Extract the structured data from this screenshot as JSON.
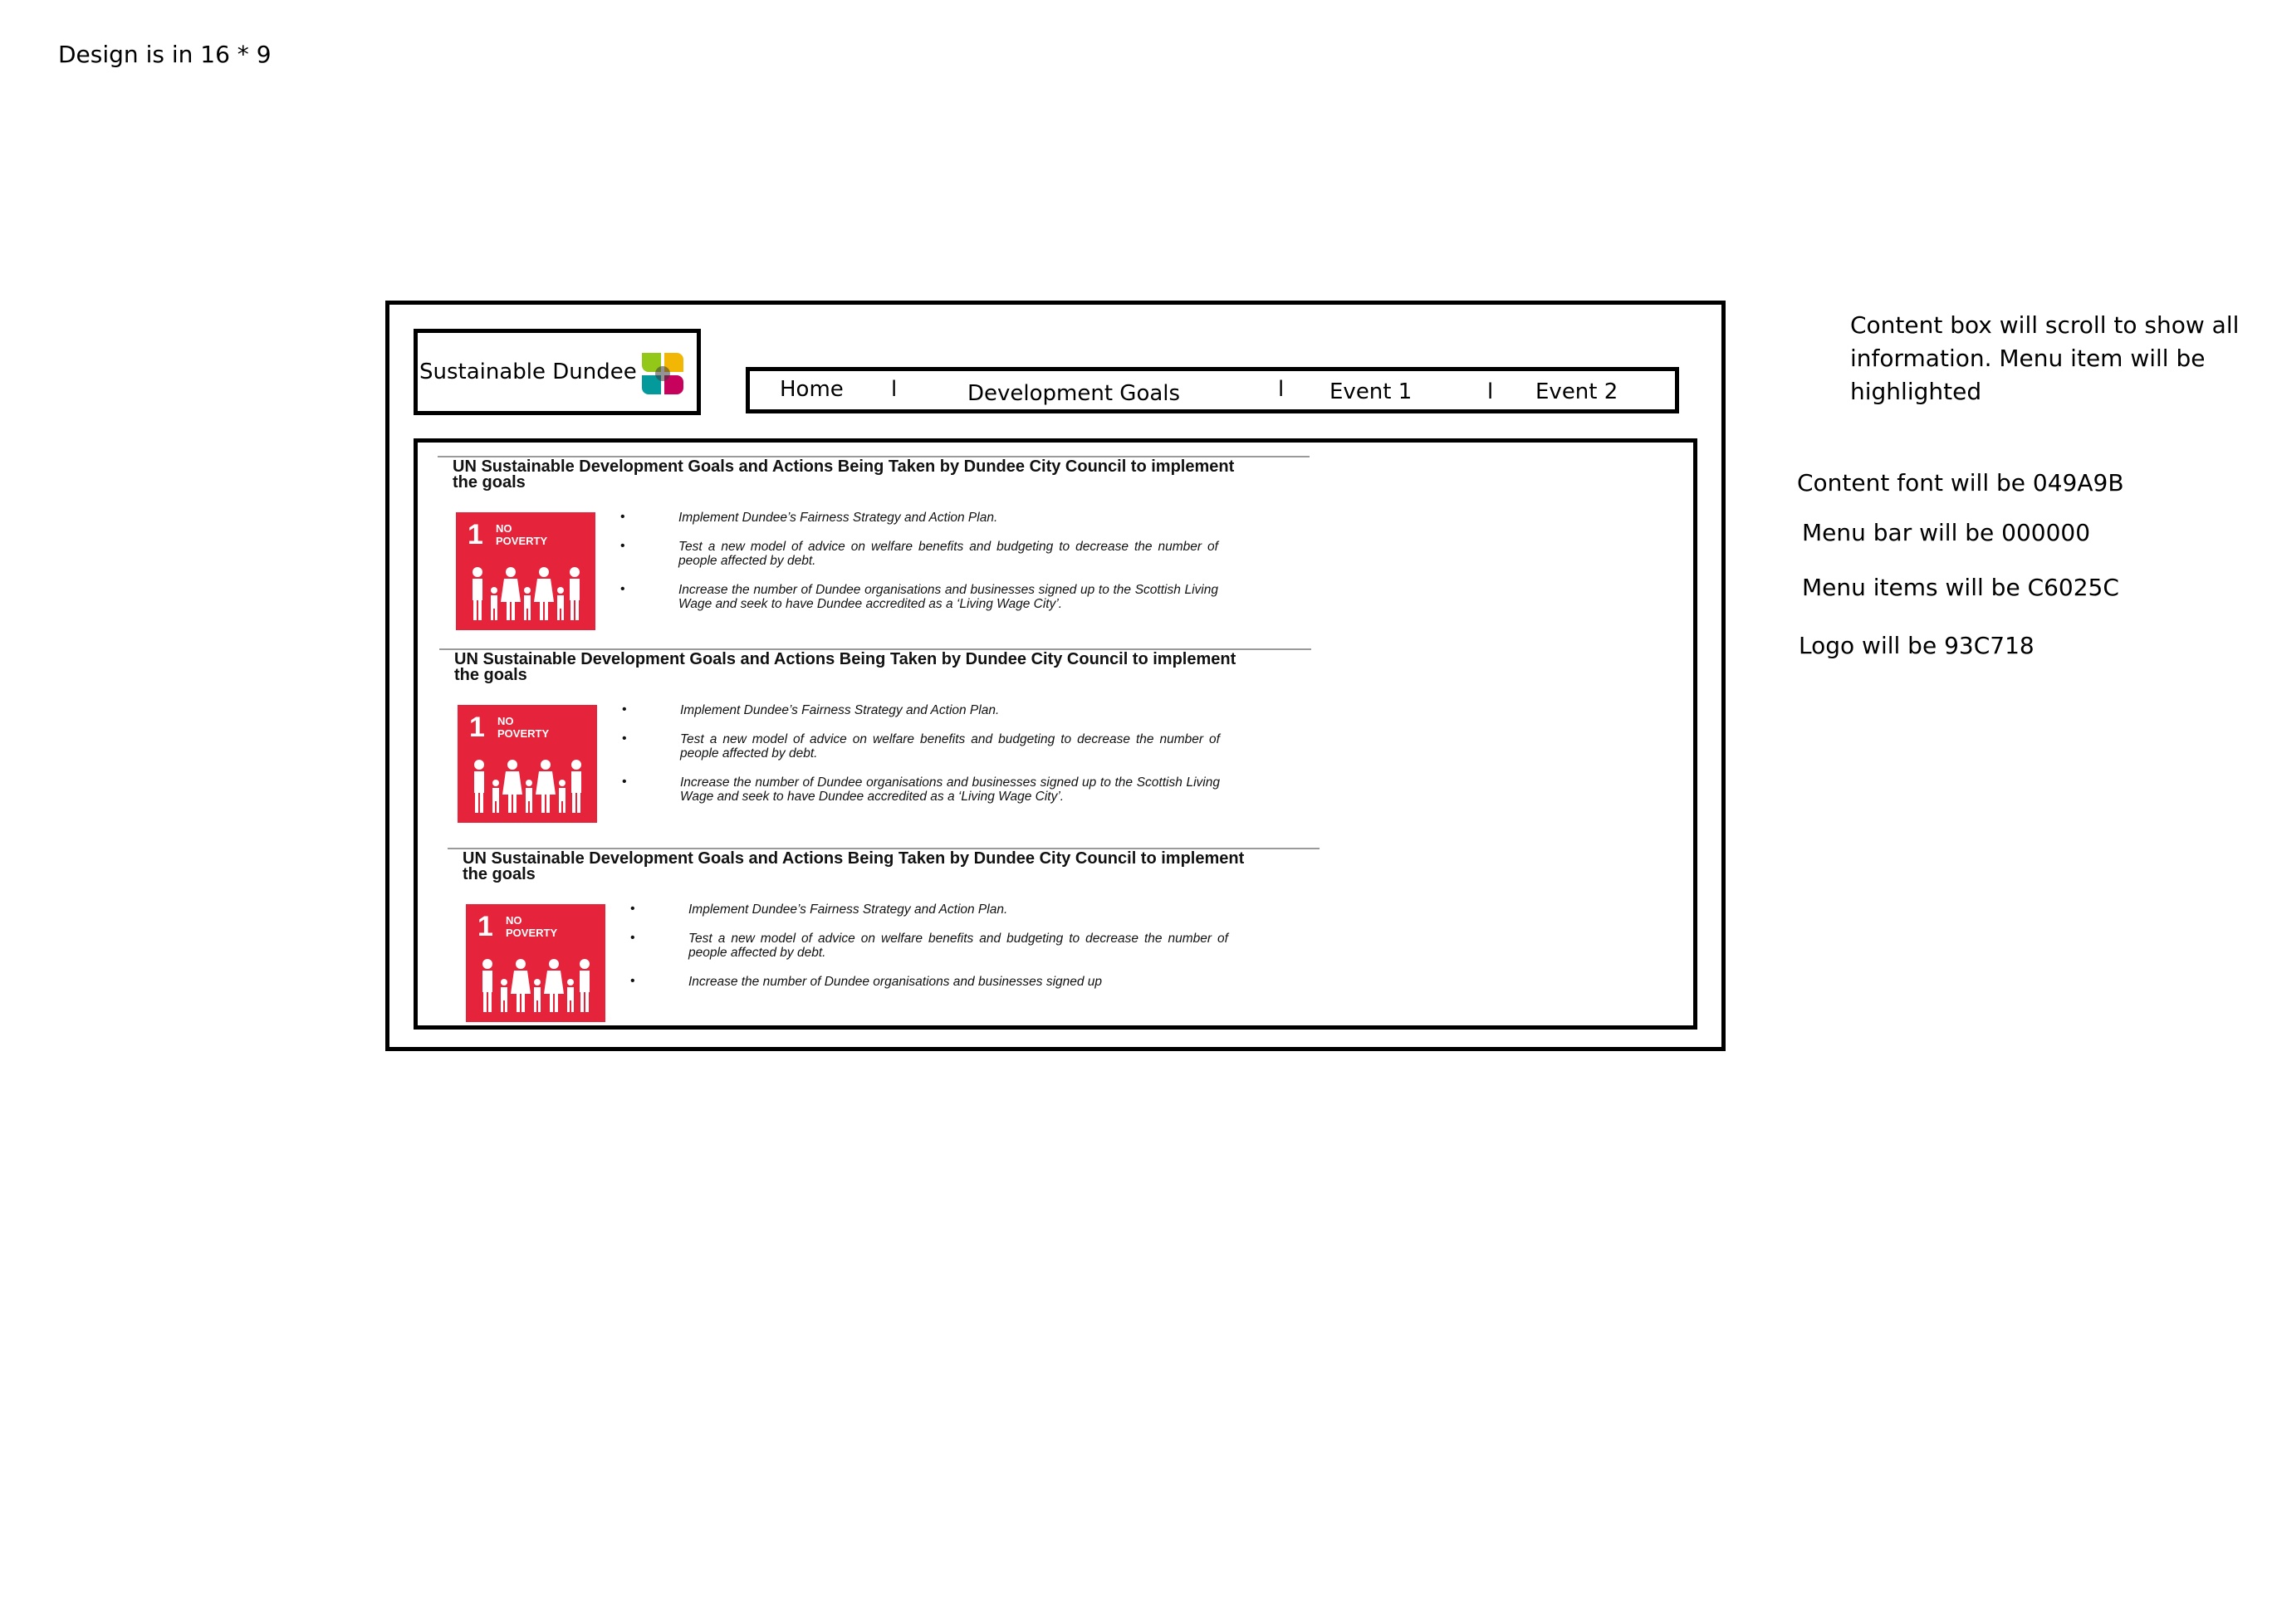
{
  "notes": {
    "format": "Design is in 16 * 9",
    "scroll": "Content box will scroll to show all information. Menu item will be highlighted",
    "content_font": "Content font will be 049A9B",
    "menu_bar": "Menu bar will be 000000",
    "menu_items": "Menu items will be C6025C",
    "logo": "Logo will be 93C718"
  },
  "logo": {
    "text": "Sustainable Dundee",
    "icon": "four-leaf-logo-icon",
    "colors": [
      "#93C718",
      "#F2B705",
      "#049A9B",
      "#C6025C"
    ]
  },
  "menu": {
    "items": [
      {
        "label": "Home"
      },
      {
        "label": "Development Goals"
      },
      {
        "label": "Event 1"
      },
      {
        "label": "Event 2"
      }
    ],
    "separator": "l"
  },
  "sections": [
    {
      "heading": "UN Sustainable Development Goals and Actions Being Taken by Dundee City Council to implement the goals",
      "tile": {
        "number": "1",
        "label": "NO POVERTY",
        "color": "#E5243B"
      },
      "actions": [
        "Implement Dundee’s Fairness Strategy and Action Plan.",
        "Test a new model of advice on welfare benefits and budgeting to decrease the number of people affected by debt.",
        "Increase the number of Dundee organisations and businesses signed up to the Scottish Living Wage and seek to have Dundee accredited as a ‘Living Wage City’."
      ]
    },
    {
      "heading": "UN Sustainable Development Goals and Actions Being Taken by Dundee City Council to implement the goals",
      "tile": {
        "number": "1",
        "label": "NO POVERTY",
        "color": "#E5243B"
      },
      "actions": [
        "Implement Dundee’s Fairness Strategy and Action Plan.",
        "Test a new model of advice on welfare benefits and budgeting to decrease the number of people affected by debt.",
        "Increase the number of Dundee organisations and businesses signed up to the Scottish Living Wage and seek to have Dundee accredited as a ‘Living Wage City’."
      ]
    },
    {
      "heading": "UN Sustainable Development Goals and Actions Being Taken by Dundee City Council to implement the goals",
      "tile": {
        "number": "1",
        "label": "NO POVERTY",
        "color": "#E5243B"
      },
      "actions": [
        "Implement Dundee’s Fairness Strategy and Action Plan.",
        "Test a new model of advice on welfare benefits and budgeting to decrease the number of people affected by debt.",
        "Increase the number of Dundee organisations and businesses signed up"
      ]
    }
  ]
}
